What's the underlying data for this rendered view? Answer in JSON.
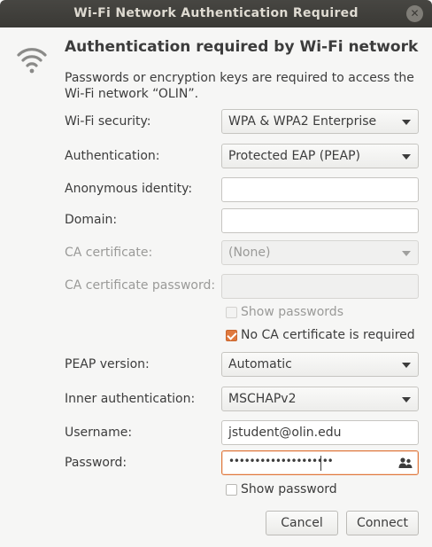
{
  "window": {
    "title": "Wi-Fi Network Authentication Required"
  },
  "heading": "Authentication required by Wi-Fi network",
  "description": "Passwords or encryption keys are required to access the Wi-Fi network “OLIN”.",
  "fields": {
    "wifi_security": {
      "label": "Wi-Fi security:",
      "value": "WPA & WPA2 Enterprise"
    },
    "authentication": {
      "label": "Authentication:",
      "value": "Protected EAP (PEAP)"
    },
    "anonymous_identity": {
      "label": "Anonymous identity:",
      "value": ""
    },
    "domain": {
      "label": "Domain:",
      "value": ""
    },
    "ca_certificate": {
      "label": "CA certificate:",
      "value": "(None)"
    },
    "ca_certificate_password": {
      "label": "CA certificate password:",
      "value": ""
    },
    "show_passwords": {
      "label": "Show passwords",
      "checked": false
    },
    "no_ca_required": {
      "label": "No CA certificate is required",
      "checked": true
    },
    "peap_version": {
      "label": "PEAP version:",
      "value": "Automatic"
    },
    "inner_authentication": {
      "label": "Inner authentication:",
      "value": "MSCHAPv2"
    },
    "username": {
      "label": "Username:",
      "value": "jstudent@olin.edu"
    },
    "password": {
      "label": "Password:",
      "value": "••••••••••••••••••••"
    },
    "show_password": {
      "label": "Show password",
      "checked": false
    }
  },
  "buttons": {
    "cancel": "Cancel",
    "connect": "Connect"
  },
  "icons": {
    "close": "close-icon",
    "wifi": "wifi-icon",
    "people": "people-icon",
    "dropdown": "chevron-down-icon"
  },
  "colors": {
    "accent": "#e0793e",
    "titlebar": "#3d3c38",
    "background": "#f6f6f5"
  }
}
